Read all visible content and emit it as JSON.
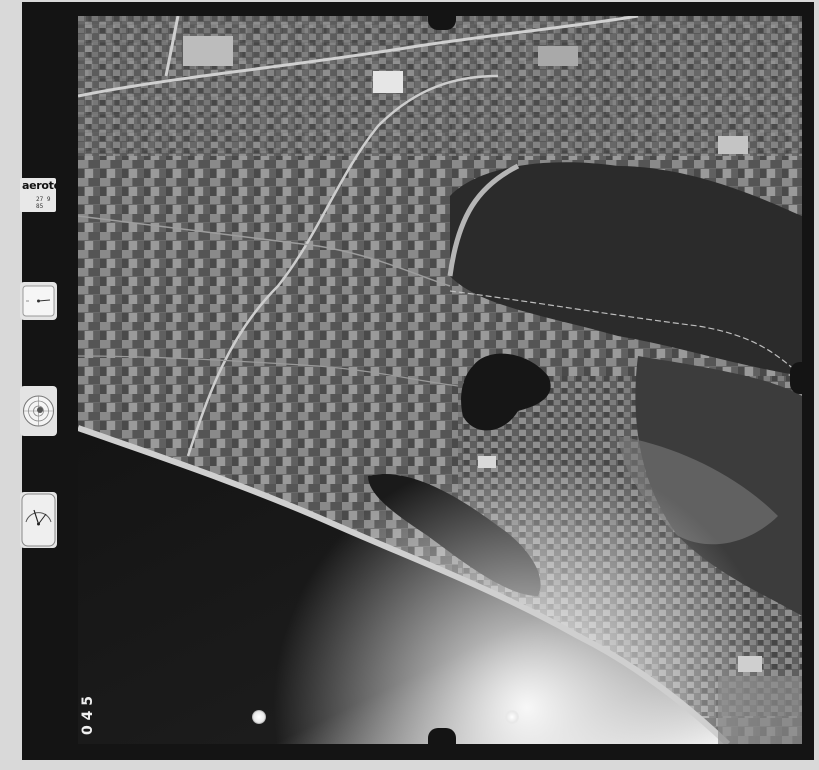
{
  "side_panel": {
    "brand_label": "aerotop",
    "date_label": "27 9 85"
  },
  "film": {
    "frame_number": "0 4 5"
  },
  "colors": {
    "frame": "#141414",
    "paper": "#d9d9d9",
    "sea": "#151515",
    "land": "#5a5a5a",
    "beach": "#c8c8c8"
  },
  "icons": {
    "altimeter": "altimeter-dial-icon",
    "level": "bubble-level-icon",
    "gauge": "clock-gauge-icon"
  }
}
